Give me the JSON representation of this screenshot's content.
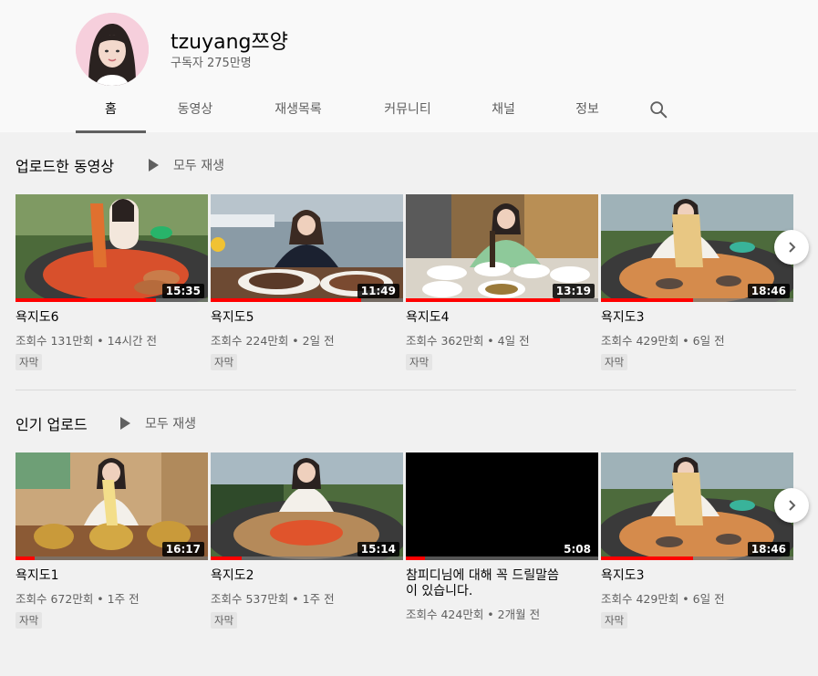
{
  "channel": {
    "name": "tzuyang쯔양",
    "subscribers": "구독자 275만명"
  },
  "tabs": [
    {
      "label": "홈",
      "active": true
    },
    {
      "label": "동영상"
    },
    {
      "label": "재생목록"
    },
    {
      "label": "커뮤니티"
    },
    {
      "label": "채널"
    },
    {
      "label": "정보"
    }
  ],
  "icons": {
    "search": "search-icon",
    "next": "chevron-right-icon",
    "play": "play-icon"
  },
  "colors": {
    "progress": "#ff0000",
    "text_secondary": "#606060",
    "background": "#f1f1f1"
  },
  "shelves": [
    {
      "title": "업로드한 동영상",
      "play_all": "모두 재생",
      "videos": [
        {
          "title": "욕지도6",
          "meta": "조회수 131만회 • 14시간 전",
          "badge": "자막",
          "duration": "15:35",
          "watched": 0.73
        },
        {
          "title": "욕지도5",
          "meta": "조회수 224만회 • 2일 전",
          "badge": "자막",
          "duration": "11:49",
          "watched": 0.78
        },
        {
          "title": "욕지도4",
          "meta": "조회수 362만회 • 4일 전",
          "badge": "자막",
          "duration": "13:19",
          "watched": 0.8
        },
        {
          "title": "욕지도3",
          "meta": "조회수 429만회 • 6일 전",
          "badge": "자막",
          "duration": "18:46",
          "watched": 0.48
        }
      ]
    },
    {
      "title": "인기 업로드",
      "play_all": "모두 재생",
      "videos": [
        {
          "title": "욕지도1",
          "meta": "조회수 672만회 • 1주 전",
          "badge": "자막",
          "duration": "16:17",
          "watched": 0.1
        },
        {
          "title": "욕지도2",
          "meta": "조회수 537만회 • 1주 전",
          "badge": "자막",
          "duration": "15:14",
          "watched": 0.16
        },
        {
          "title": "참피디님에 대해 꼭 드릴말씀\n이 있습니다.",
          "meta": "조회수 424만회 • 2개월 전",
          "badge": "",
          "duration": "5:08",
          "watched": 0.1
        },
        {
          "title": "욕지도3",
          "meta": "조회수 429만회 • 6일 전",
          "badge": "자막",
          "duration": "18:46",
          "watched": 0.48
        }
      ]
    }
  ]
}
